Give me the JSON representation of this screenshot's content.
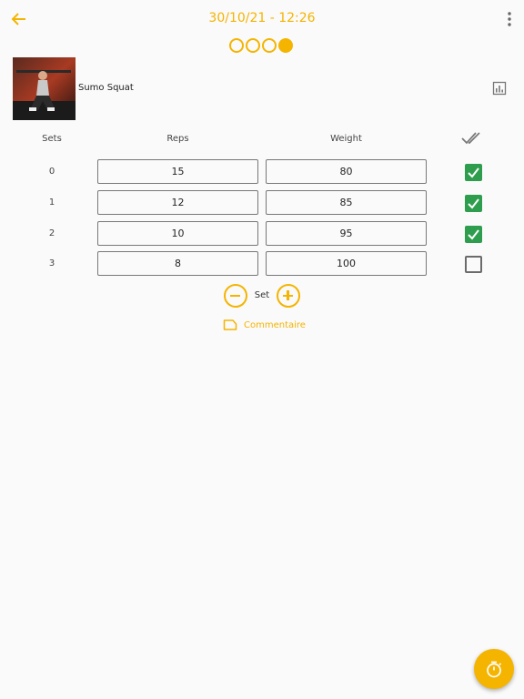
{
  "header": {
    "title": "30/10/21 - 12:26",
    "back_icon": "arrow-left-icon",
    "menu_icon": "more-vert-icon",
    "accent_color": "#f4b400"
  },
  "progress_dots": {
    "count": 4,
    "filled_index": 3
  },
  "exercise": {
    "name": "Sumo Squat",
    "stats_icon": "bar-chart-icon"
  },
  "table": {
    "headers": {
      "sets": "Sets",
      "reps": "Reps",
      "weight": "Weight"
    },
    "check_all_icon": "double-check-icon",
    "rows": [
      {
        "set": "0",
        "reps": "15",
        "weight": "80",
        "done": true
      },
      {
        "set": "1",
        "reps": "12",
        "weight": "85",
        "done": true
      },
      {
        "set": "2",
        "reps": "10",
        "weight": "95",
        "done": true
      },
      {
        "set": "3",
        "reps": "8",
        "weight": "100",
        "done": false
      }
    ]
  },
  "set_controls": {
    "label": "Set",
    "remove_icon": "minus-circle-icon",
    "add_icon": "plus-circle-icon"
  },
  "comment": {
    "label": "Commentaire",
    "icon": "label-outline-icon"
  },
  "fab": {
    "icon": "timer-icon"
  },
  "colors": {
    "checkbox_on": "#2e9e4e",
    "checkbox_off_border": "#6b6b6b"
  }
}
